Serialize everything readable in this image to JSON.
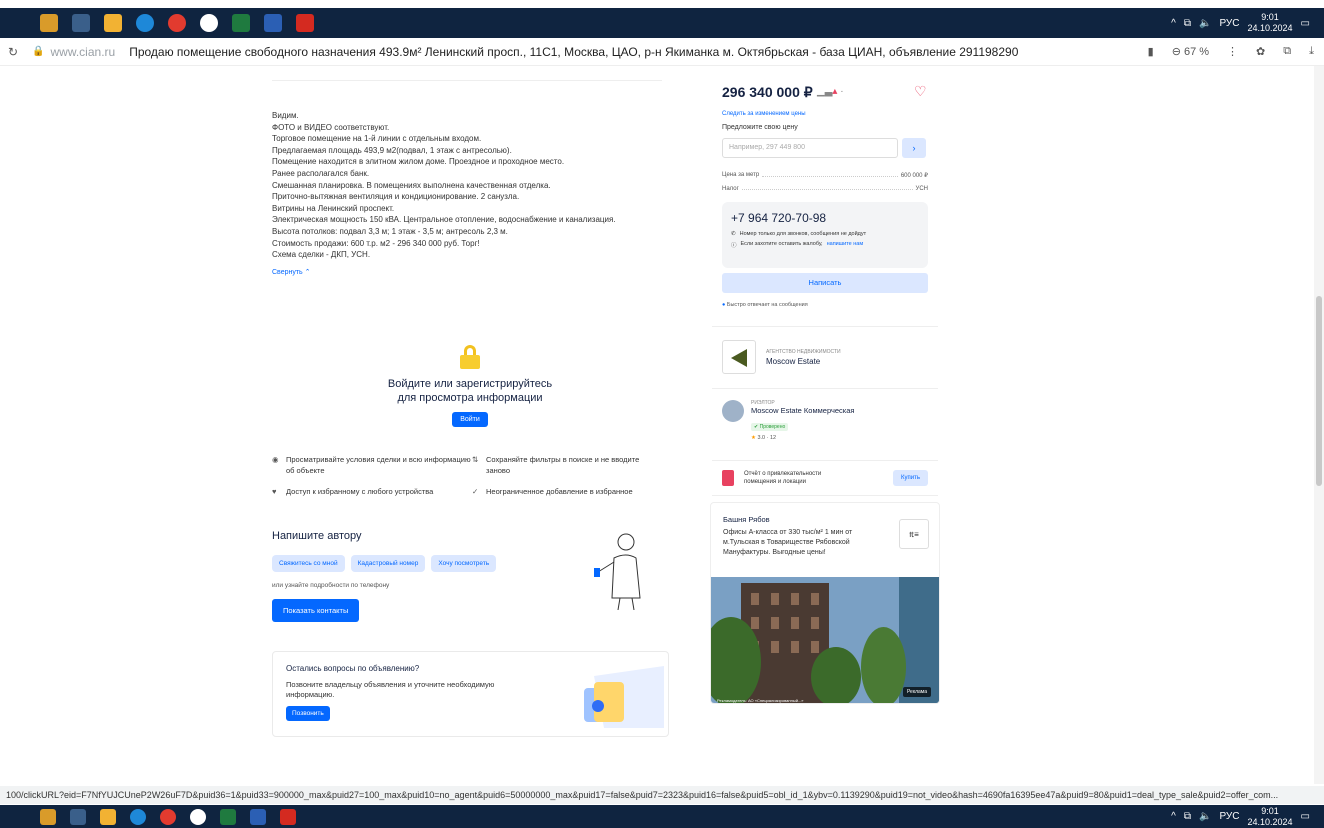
{
  "taskbar": {
    "lang": "РУС",
    "time": "9:01",
    "date": "24.10.2024"
  },
  "browser": {
    "domain": "www.cian.ru",
    "page_title": "Продаю помещение свободного назначения 493.9м² Ленинский просп., 11С1, Москва, ЦАО, р-н Якиманка м. Октябрьская - база ЦИАН, объявление 291198290",
    "zoom": "67 %",
    "status_url": "100/clickURL?eid=F7NfYUJCUneP2W26uF7D&puid36=1&puid33=900000_max&puid27=100_max&puid10=no_agent&puid6=50000000_max&puid17=false&puid7=2323&puid16=false&puid5=obl_id_1&ybv=0.1139290&puid19=not_video&hash=4690fa16395ee47a&puid9=80&puid1=deal_type_sale&puid2=offer_com..."
  },
  "description": {
    "lines": [
      "Видим.",
      "ФОТО и ВИДЕО соответствуют.",
      "Торговое помещение на 1-й линии с отдельным входом.",
      "Предлагаемая площадь 493,9 м2(подвал, 1 этаж с антресолью).",
      "Помещение находится в элитном жилом доме. Проездное и проходное место.",
      "Ранее располагался банк.",
      "Смешанная планировка. В помещениях выполнена качественная отделка.",
      "Приточно-вытяжная вентиляция и кондиционирование. 2 санузла.",
      "Витрины на Ленинский проспект.",
      "Электрическая мощность 150 кВА. Центральное отопление, водоснабжение и канализация.",
      "Высота потолков: подвал 3,3 м; 1 этаж - 3,5 м; антресоль 2,3 м.",
      "Стоимость продажи: 600 т.р. м2 - 296 340 000 руб. Торг!",
      "Схема сделки - ДКП, УСН."
    ],
    "collapse": "Свернуть"
  },
  "login_gate": {
    "title_line1": "Войдите или зарегистрируйтесь",
    "title_line2": "для просмотра информации",
    "button": "Войти",
    "features": [
      "Просматривайте условия сделки и всю информацию об объекте",
      "Сохраняйте фильтры в поиске и не вводите заново",
      "Доступ к избранному с любого устройства",
      "Неограниченное добавление в избранное"
    ]
  },
  "write_author": {
    "title": "Напишите автору",
    "chips": [
      "Свяжитесь со мной",
      "Кадастровый номер",
      "Хочу посмотреть"
    ],
    "hint": "или узнайте подробности по телефону",
    "button": "Показать контакты"
  },
  "questions": {
    "title": "Остались вопросы по объявлению?",
    "text": "Позвоните владельцу объявления и уточните необходимую информацию.",
    "button": "Позвонить"
  },
  "offer": {
    "price": "296 340 000 ₽",
    "follow": "Следить за изменением цены",
    "propose_label": "Предложите свою цену",
    "propose_placeholder": "Например, 297 449 800",
    "go": "›",
    "price_per_m_label": "Цена за метр",
    "price_per_m_value": "600 000 ₽",
    "tax_label": "Налог",
    "tax_value": "УСН",
    "phone": "+7 964 720-70-98",
    "note1": "Номер только для звонков, сообщения не дойдут",
    "note2": "Если захотите оставить жалобу,",
    "note2_link": "напишите нам",
    "write_button": "Написать",
    "fast_reply": "Быстро отвечает на сообщения"
  },
  "agency": {
    "label": "АГЕНТСТВО НЕДВИЖИМОСТИ",
    "name": "Moscow Estate"
  },
  "realtor": {
    "label": "РИЭЛТОР",
    "name": "Moscow Estate Коммерческая",
    "badge": "Проверено",
    "rating": "3.0 · 12"
  },
  "report": {
    "text": "Отчёт о привлекательности помещения и локации",
    "button": "Купить"
  },
  "ad": {
    "title": "Башня Рябов",
    "text": "Офисы А-класса от 330 тыс/м² 1 мин от м.Тульская в Товариществе Рябовской Мануфактуры. Выгодные цены!",
    "badge": "Реклама",
    "legal": "Рекламодатель: АО «Специализированный...»"
  },
  "colors": {
    "accent": "#0468ff",
    "heart": "#e84260",
    "taskbar": "#0f2440"
  }
}
